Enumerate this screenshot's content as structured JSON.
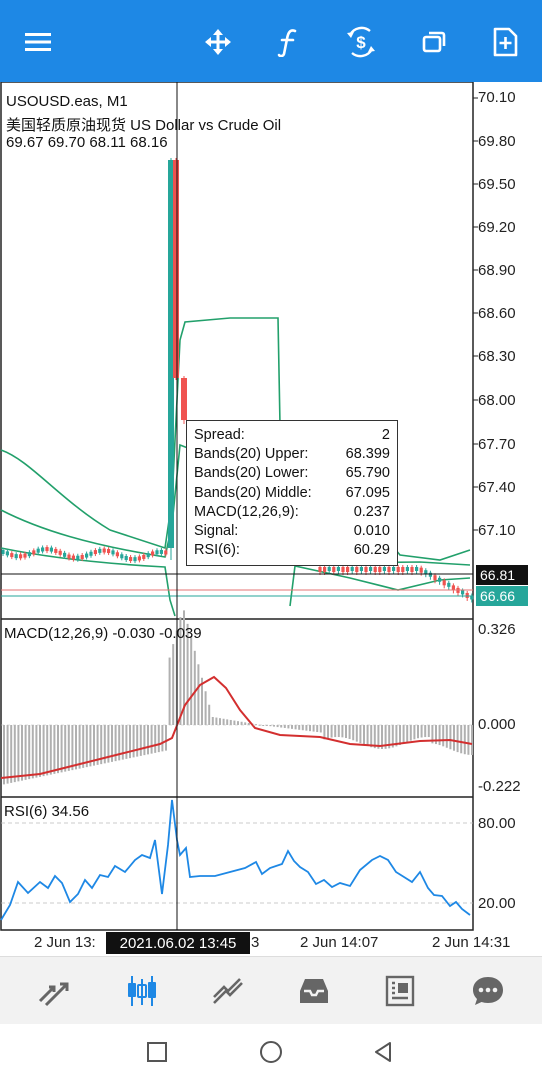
{
  "toolbar": {
    "icons": [
      "menu-icon",
      "crosshair-icon",
      "indicators-icon",
      "trade-icon",
      "windows-icon",
      "new-order-icon"
    ]
  },
  "chart": {
    "symbol": "USOUSD.eas, M1",
    "description": "美国轻质原油现货 US Dollar vs Crude Oil",
    "ohlc": "69.67 69.70 68.11 68.16",
    "price_axis": [
      "70.10",
      "69.80",
      "69.50",
      "69.20",
      "68.90",
      "68.60",
      "68.30",
      "68.00",
      "67.70",
      "67.40",
      "67.10"
    ],
    "bid_tag": "66.81",
    "ask_tag": "66.66",
    "colors": {
      "bull": "#26a69a",
      "bear": "#ef5350",
      "bands": "#22a06b",
      "macd_signal": "#d32f2f",
      "macd_hist": "#b0b0b0",
      "rsi": "#1e88e5",
      "toolbar": "#1e88e5"
    },
    "info": {
      "spread_label": "Spread:",
      "spread_value": "2",
      "upper_label": "Bands(20) Upper:",
      "upper_value": "68.399",
      "lower_label": "Bands(20) Lower:",
      "lower_value": "65.790",
      "middle_label": "Bands(20) Middle:",
      "middle_value": "67.095",
      "macd_label": "MACD(12,26,9):",
      "macd_value": "0.237",
      "signal_label": "Signal:",
      "signal_value": "0.010",
      "rsi_label": "RSI(6):",
      "rsi_value": "60.29"
    },
    "macd": {
      "title": "MACD(12,26,9) -0.030 -0.039",
      "axis": [
        "0.326",
        "0.000",
        "-0.222"
      ]
    },
    "rsi": {
      "title": "RSI(6) 34.56",
      "axis": [
        "80.00",
        "20.00"
      ]
    },
    "time_axis": {
      "left": "2 Jun 13:",
      "cursor": "2021.06.02 13:45",
      "after_cursor": "3",
      "mid": "2 Jun 14:07",
      "right": "2 Jun 14:31"
    }
  },
  "bottom_nav": {
    "items": [
      "quotes-icon",
      "chart-icon",
      "trade-icon",
      "history-icon",
      "news-icon",
      "chat-icon"
    ],
    "active": "chart-icon"
  },
  "system_nav": [
    "recents-button",
    "home-button",
    "back-button"
  ]
}
